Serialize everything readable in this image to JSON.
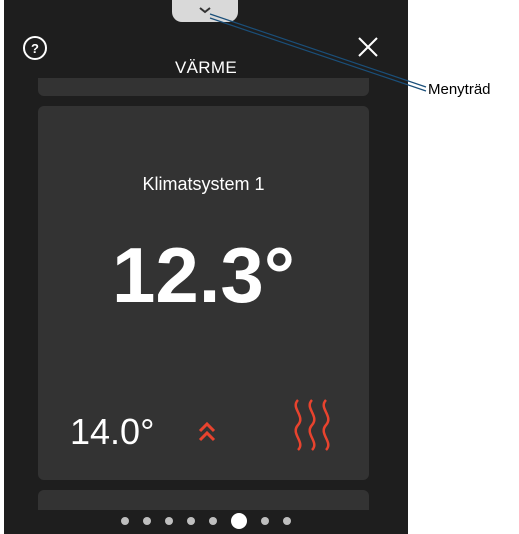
{
  "header": {
    "title": "VÄRME",
    "help_icon": "question-mark-icon",
    "help_glyph": "?",
    "close_icon": "close-icon",
    "menu_tab_icon": "chevron-down-icon"
  },
  "card": {
    "system_name": "Klimatsystem 1",
    "current_temperature": "12.3°",
    "setpoint_temperature": "14.0°",
    "raise_icon": "double-chevron-up-icon",
    "heat_icon": "heat-waves-icon"
  },
  "pagination": {
    "page_count": 8,
    "active_page": 6
  },
  "callout": {
    "label": "Menyträd"
  },
  "colors": {
    "screen_background": "#1e1e1e",
    "card_background": "#333333",
    "accent_red": "#e8432e",
    "text": "#ffffff"
  }
}
